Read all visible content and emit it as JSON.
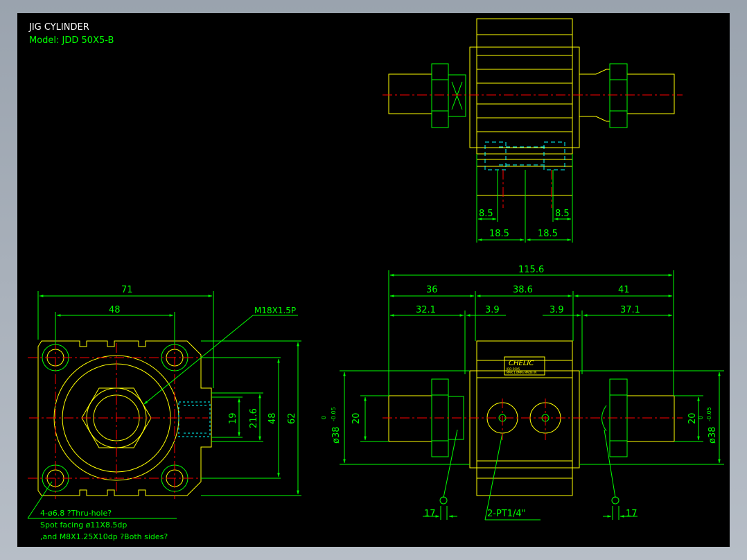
{
  "title": "JIG CYLINDER",
  "model": "Model: JDD 50X5-B",
  "colors": {
    "background": "#000000",
    "outline": "#ffff00",
    "dimension": "#00ff00",
    "center": "#ff0000",
    "hidden": "#00ffff",
    "frame": "#9aa3ae"
  },
  "top_view": {
    "dims": [
      "8.5",
      "8.5",
      "18.5",
      "18.5"
    ]
  },
  "front_view": {
    "overall": "115.6",
    "dims_row1": [
      "36",
      "38.6",
      "41"
    ],
    "dims_row2": [
      "32.1",
      "3.9",
      "3.9",
      "37.1"
    ],
    "height_left": "20",
    "height_right": "20",
    "bore_left": {
      "prefix": "ø38",
      "upper": "0",
      "lower": "-0.05"
    },
    "bore_right": {
      "prefix": "ø38",
      "upper": "0",
      "lower": "-0.05"
    },
    "nameplate": "CHELIC",
    "plate_line1": "JDD-50X5",
    "plate_line2": "MAX 1.0MPa  MADE IN",
    "port_note": "2-PT1/4\"",
    "rod_left": "17",
    "rod_right": "17"
  },
  "side_view": {
    "width_outer": "71",
    "width_inner": "48",
    "thread_note": "M18X1.5P",
    "heights": [
      "19",
      "21.6",
      "48",
      "62"
    ],
    "notes": [
      "4-ø6.8   ?Thru-hole?",
      "Spot facing  ø11X8.5dp",
      ",and M8X1.25X10dp ?Both sides?"
    ]
  }
}
